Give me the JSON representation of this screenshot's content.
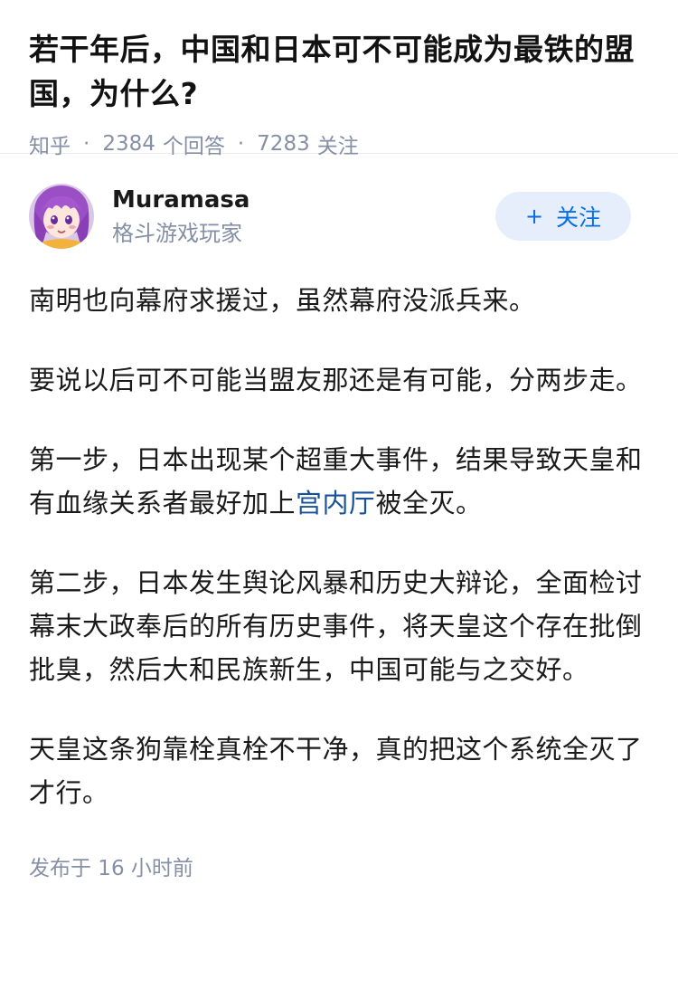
{
  "question": {
    "title": "若干年后，中国和日本可不可能成为最铁的盟国，为什么?",
    "source": "知乎",
    "answer_count": "2384",
    "answer_label": "个回答",
    "follow_count": "7283",
    "follow_label": "关注"
  },
  "answer": {
    "author": {
      "name": "Muramasa",
      "headline": "格斗游戏玩家",
      "avatar_icon": "anime-girl-avatar-icon"
    },
    "follow_button": {
      "plus": "+",
      "label": "关注"
    },
    "paragraphs": {
      "p1": "南明也向幕府求援过，虽然幕府没派兵来。",
      "p2": "要说以后可不可能当盟友那还是有可能，分两步走。",
      "p3_before": "第一步，日本出现某个超重大事件，结果导致天皇和有血缘关系者最好加上",
      "p3_link": "宫内厅",
      "p3_after": "被全灭。",
      "p4": "第二步，日本发生舆论风暴和历史大辩论，全面检讨幕末大政奉后的所有历史事件，将天皇这个存在批倒批臭，然后大和民族新生，中国可能与之交好。",
      "p5": "天皇这条狗靠栓真栓不干净，真的把这个系统全灭了才行。"
    },
    "publish_time": "发布于 16 小时前"
  },
  "colors": {
    "accent": "#056de8",
    "follow_bg": "#e5eefa",
    "meta": "#8590a6",
    "link": "#175199"
  }
}
